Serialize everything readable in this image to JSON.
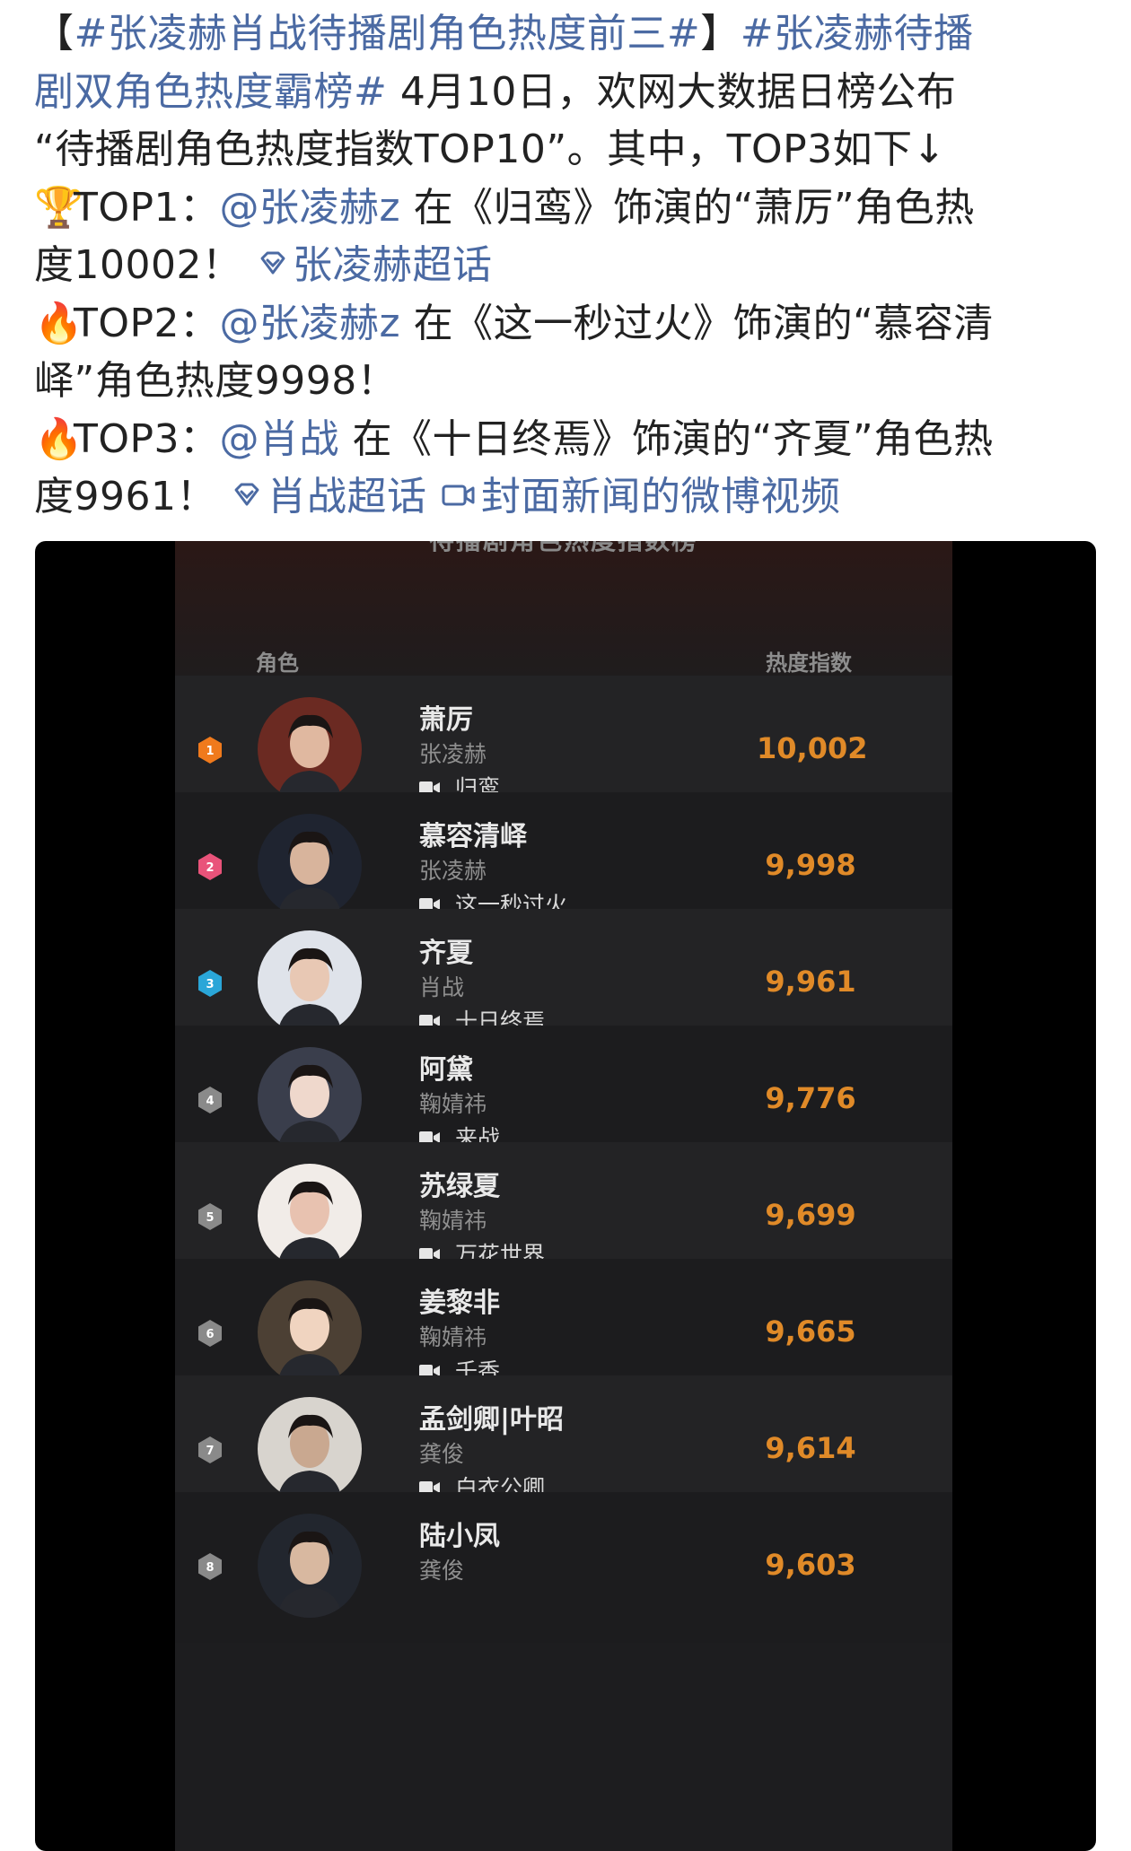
{
  "post": {
    "lines": [
      [
        {
          "t": "【",
          "c": "text"
        },
        {
          "t": "#张凌赫肖战待播剧角色热度前三#",
          "c": "link"
        },
        {
          "t": "】",
          "c": "text"
        },
        {
          "t": "#张凌赫待播",
          "c": "link"
        }
      ],
      [
        {
          "t": "剧双角色热度霸榜#",
          "c": "link"
        },
        {
          "t": " 4月10日，欢网大数据日榜公布",
          "c": "text"
        }
      ],
      [
        {
          "t": "“待播剧角色热度指数TOP10”。其中，TOP3如下↓",
          "c": "text"
        }
      ],
      [
        {
          "t": "🏆",
          "c": "emoji trophy"
        },
        {
          "t": "TOP1：",
          "c": "text"
        },
        {
          "t": "@张凌赫z",
          "c": "link"
        },
        {
          "t": " 在《归鸾》饰演的“萧厉”角色热",
          "c": "text"
        }
      ],
      [
        {
          "t": "度10002！ ",
          "c": "text"
        },
        {
          "t": "◇",
          "c": "diamond"
        },
        {
          "t": "张凌赫超话",
          "c": "link"
        }
      ],
      [
        {
          "t": "🔥",
          "c": "emoji fire"
        },
        {
          "t": "TOP2：",
          "c": "text"
        },
        {
          "t": "@张凌赫z",
          "c": "link"
        },
        {
          "t": " 在《这一秒过火》饰演的“慕容清",
          "c": "text"
        }
      ],
      [
        {
          "t": "峄”角色热度9998！",
          "c": "text"
        }
      ],
      [
        {
          "t": "🔥",
          "c": "emoji fire"
        },
        {
          "t": "TOP3：",
          "c": "text"
        },
        {
          "t": "@肖战",
          "c": "link"
        },
        {
          "t": " 在《十日终焉》饰演的“齐夏”角色热",
          "c": "text"
        }
      ],
      [
        {
          "t": "度9961！ ",
          "c": "text"
        },
        {
          "t": "◇",
          "c": "diamond"
        },
        {
          "t": "肖战超话 ",
          "c": "link"
        },
        {
          "t": "▭",
          "c": "video"
        },
        {
          "t": "封面新闻的微博视频",
          "c": "link"
        }
      ]
    ]
  },
  "screenshot": {
    "title": "待播剧角色热度指数榜",
    "header_role": "角色",
    "header_heat": "热度指数",
    "rank_colors": [
      "#f07a1c",
      "#e9537a",
      "#2aa6d8",
      "#8a8a8a",
      "#8a8a8a",
      "#8a8a8a",
      "#8a8a8a",
      "#8a8a8a"
    ],
    "rows": [
      {
        "rank": "1",
        "role": "萧厉",
        "actor": "张凌赫",
        "drama": "归鸾",
        "heat": "10,002"
      },
      {
        "rank": "2",
        "role": "慕容清峄",
        "actor": "张凌赫",
        "drama": "这一秒过火",
        "heat": "9,998"
      },
      {
        "rank": "3",
        "role": "齐夏",
        "actor": "肖战",
        "drama": "十日终焉",
        "heat": "9,961"
      },
      {
        "rank": "4",
        "role": "阿黛",
        "actor": "鞠婧祎",
        "drama": "来战",
        "heat": "9,776"
      },
      {
        "rank": "5",
        "role": "苏绿夏",
        "actor": "鞠婧祎",
        "drama": "万花世界",
        "heat": "9,699"
      },
      {
        "rank": "6",
        "role": "姜黎非",
        "actor": "鞠婧祎",
        "drama": "千香",
        "heat": "9,665"
      },
      {
        "rank": "7",
        "role": "孟剑卿|叶昭",
        "actor": "龚俊",
        "drama": "白衣公卿",
        "heat": "9,614"
      },
      {
        "rank": "8",
        "role": "陆小凤",
        "actor": "龚俊",
        "drama": "",
        "heat": "9,603"
      }
    ]
  }
}
